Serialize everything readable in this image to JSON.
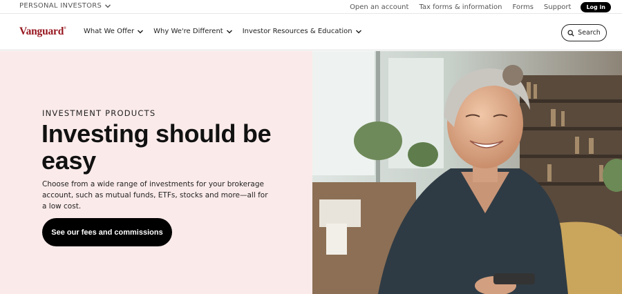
{
  "utility": {
    "audience_label": "PERSONAL INVESTORS",
    "links": [
      "Open an account",
      "Tax forms & information",
      "Forms",
      "Support"
    ],
    "login_label": "Log in"
  },
  "nav": {
    "logo_text": "Vanguard",
    "items": [
      "What We Offer",
      "Why We're Different",
      "Investor Resources & Education"
    ],
    "search_label": "Search"
  },
  "hero": {
    "eyebrow": "INVESTMENT PRODUCTS",
    "headline": "Investing should be easy",
    "body": "Choose from a wide range of investments for your brokerage account, such as mutual funds, ETFs, stocks and more—all for a low cost.",
    "cta_label": "See our fees and commissions",
    "background_color": "#fbeaea",
    "image_description_icon": "smiling-woman-photo"
  },
  "colors": {
    "brand": "#96151d",
    "button_dark": "#000000"
  }
}
